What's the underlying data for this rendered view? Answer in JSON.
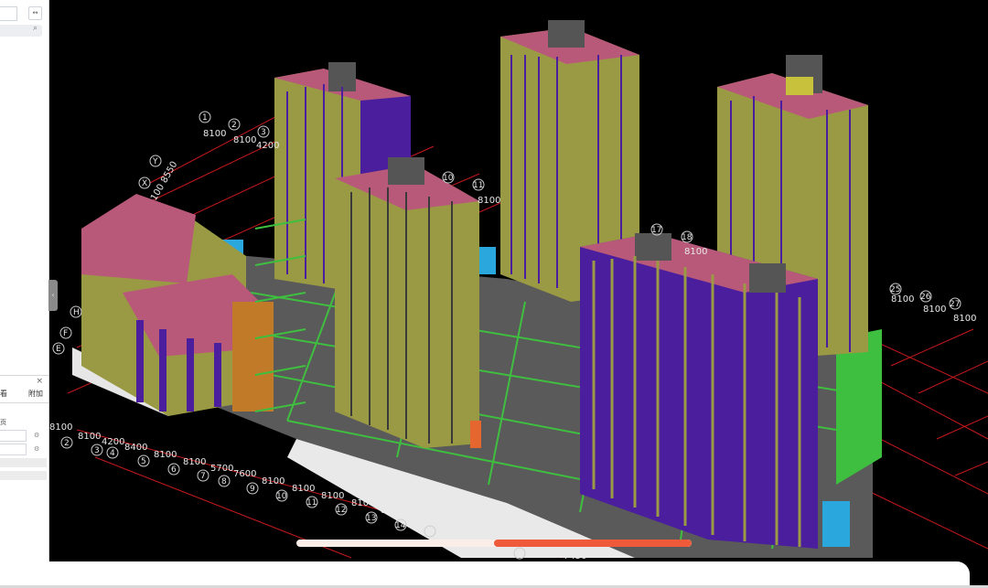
{
  "left_panel": {
    "collapse_btn": "↔",
    "search_icon": "search-icon",
    "tab_left": "看",
    "tab_right": "附加",
    "close": "×",
    "row_label": "页",
    "gear": "⚙"
  },
  "viewport": {
    "axis_labels_top": [
      {
        "text": "1"
      },
      {
        "text": "2"
      },
      {
        "text": "3"
      },
      {
        "text": "8100"
      },
      {
        "text": "8100"
      },
      {
        "text": "4200"
      },
      {
        "text": "10"
      },
      {
        "text": "11"
      },
      {
        "text": "8100"
      },
      {
        "text": "17"
      },
      {
        "text": "18"
      },
      {
        "text": "8100"
      },
      {
        "text": "25"
      },
      {
        "text": "26"
      },
      {
        "text": "27"
      },
      {
        "text": "8100"
      },
      {
        "text": "8100"
      },
      {
        "text": "8100"
      }
    ],
    "axis_labels_left": [
      {
        "text": "Y"
      },
      {
        "text": "X"
      },
      {
        "text": "100 8550"
      },
      {
        "text": "H"
      },
      {
        "text": "F"
      },
      {
        "text": "E"
      }
    ],
    "axis_labels_bottom": [
      {
        "text": "2"
      },
      {
        "text": "3"
      },
      {
        "text": "4"
      },
      {
        "text": "5"
      },
      {
        "text": "6"
      },
      {
        "text": "7"
      },
      {
        "text": "8"
      },
      {
        "text": "9"
      },
      {
        "text": "10"
      },
      {
        "text": "11"
      },
      {
        "text": "12"
      },
      {
        "text": "13"
      },
      {
        "text": "14"
      },
      {
        "text": "15"
      },
      {
        "text": "18"
      },
      {
        "text": "8100"
      },
      {
        "text": "8100"
      },
      {
        "text": "4200"
      },
      {
        "text": "8400"
      },
      {
        "text": "8100"
      },
      {
        "text": "8100"
      },
      {
        "text": "5700"
      },
      {
        "text": "7600"
      },
      {
        "text": "8100"
      },
      {
        "text": "8100"
      },
      {
        "text": "8100"
      },
      {
        "text": "8100"
      },
      {
        "text": "8100"
      },
      {
        "text": "8100"
      },
      {
        "text": "8100"
      },
      {
        "text": "6750"
      },
      {
        "text": "7450"
      }
    ]
  },
  "progress": {
    "start": 0.0,
    "end": 1.0,
    "highlight_start": 0.5,
    "highlight_end": 1.0
  },
  "colors": {
    "grid_red": "#c5191d",
    "slab_grey": "#5a5a5a",
    "green_beam": "#3fbf3f",
    "roof_magenta": "#b8597a",
    "wall_olive": "#9b9a44",
    "wall_purple": "#4b1e9e",
    "progress_fill": "#ee5a3a",
    "progress_track": "#fbeee8"
  }
}
